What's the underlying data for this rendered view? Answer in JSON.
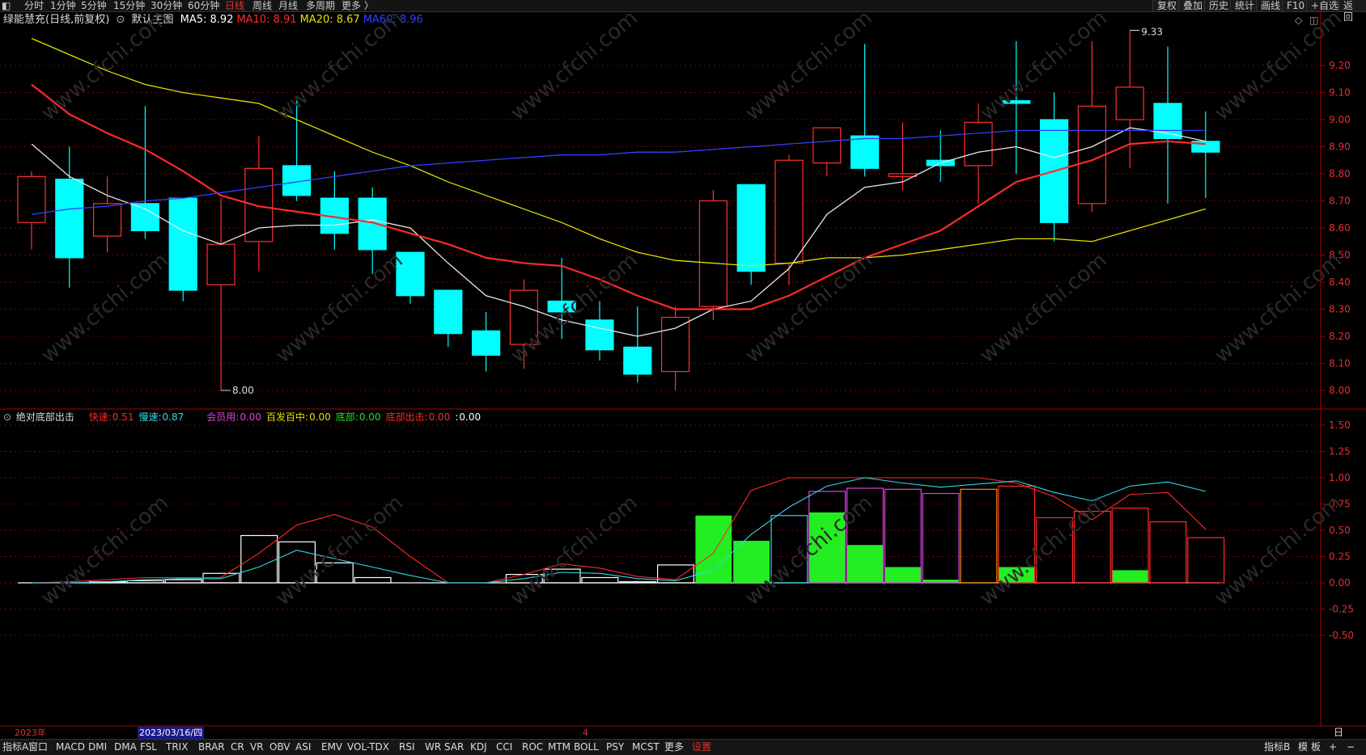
{
  "toolbar": {
    "left_tabs": [
      {
        "label": "分时",
        "x": 30
      },
      {
        "label": "1分钟",
        "x": 62
      },
      {
        "label": "5分钟",
        "x": 100
      },
      {
        "label": "15分钟",
        "x": 140
      },
      {
        "label": "30分钟",
        "x": 186
      },
      {
        "label": "60分钟",
        "x": 232
      },
      {
        "label": "日线",
        "x": 278,
        "active": true
      },
      {
        "label": "周线",
        "x": 312
      },
      {
        "label": "月线",
        "x": 344
      },
      {
        "label": "多周期",
        "x": 378
      },
      {
        "label": "更多 〉",
        "x": 422
      }
    ],
    "right_buttons": [
      "复权",
      "叠加",
      "历史",
      "统计",
      "画线",
      "F10",
      "+自选",
      "返回"
    ]
  },
  "header": {
    "stock_name": "绿能慧充(日线,前复权)",
    "main_chart": "默认主图",
    "ma": [
      {
        "label": "MA5: 8.92",
        "color": "#ffffff"
      },
      {
        "label": "MA10: 8.91",
        "color": "#ff2a2a"
      },
      {
        "label": "MA20: 8.67",
        "color": "#e0e000"
      },
      {
        "label": "MA60: 8.96",
        "color": "#3040ff"
      }
    ]
  },
  "indicator": {
    "name": "绝对底部出击",
    "values": [
      {
        "label": "快速:",
        "value": "0.51",
        "lcolor": "#ff2a2a",
        "vcolor": "#ff2a2a"
      },
      {
        "label": "慢速:",
        "value": "0.87",
        "lcolor": "#30d8e8",
        "vcolor": "#30d8e8"
      },
      {
        "label": "会员用:",
        "value": "0.00",
        "lcolor": "#e040e0",
        "vcolor": "#e040e0"
      },
      {
        "label": "百发百中:",
        "value": "0.00",
        "lcolor": "#e0e000",
        "vcolor": "#e0e000"
      },
      {
        "label": "底部:",
        "value": "0.00",
        "lcolor": "#22e022",
        "vcolor": "#22e022"
      },
      {
        "label": "底部出击:",
        "value": "0.00",
        "lcolor": "#ff2a2a",
        "vcolor": "#ff2a2a"
      },
      {
        "label": ":",
        "value": "0.00",
        "lcolor": "#ffffff",
        "vcolor": "#ffffff"
      }
    ]
  },
  "chart_data": [
    {
      "type": "candlestick",
      "title": "绿能慧充(日线,前复权)",
      "ylim": [
        7.97,
        9.33
      ],
      "yticks": [
        8.0,
        8.1,
        8.2,
        8.3,
        8.4,
        8.5,
        8.6,
        8.7,
        8.8,
        8.9,
        9.0,
        9.1,
        9.2
      ],
      "candles": [
        {
          "o": 8.62,
          "c": 8.79,
          "h": 8.81,
          "l": 8.52
        },
        {
          "o": 8.78,
          "c": 8.49,
          "h": 8.9,
          "l": 8.38
        },
        {
          "o": 8.57,
          "c": 8.69,
          "h": 8.79,
          "l": 8.51
        },
        {
          "o": 8.69,
          "c": 8.59,
          "h": 9.05,
          "l": 8.56
        },
        {
          "o": 8.71,
          "c": 8.37,
          "h": 8.71,
          "l": 8.33
        },
        {
          "o": 8.39,
          "c": 8.54,
          "h": 8.71,
          "l": 8.0
        },
        {
          "o": 8.55,
          "c": 8.82,
          "h": 8.94,
          "l": 8.44
        },
        {
          "o": 8.83,
          "c": 8.72,
          "h": 9.07,
          "l": 8.7
        },
        {
          "o": 8.71,
          "c": 8.58,
          "h": 8.81,
          "l": 8.52
        },
        {
          "o": 8.71,
          "c": 8.52,
          "h": 8.75,
          "l": 8.43
        },
        {
          "o": 8.51,
          "c": 8.35,
          "h": 8.51,
          "l": 8.32
        },
        {
          "o": 8.37,
          "c": 8.21,
          "h": 8.37,
          "l": 8.16
        },
        {
          "o": 8.22,
          "c": 8.13,
          "h": 8.29,
          "l": 8.07
        },
        {
          "o": 8.17,
          "c": 8.37,
          "h": 8.41,
          "l": 8.08
        },
        {
          "o": 8.33,
          "c": 8.29,
          "h": 8.49,
          "l": 8.19
        },
        {
          "o": 8.26,
          "c": 8.15,
          "h": 8.33,
          "l": 8.11
        },
        {
          "o": 8.16,
          "c": 8.06,
          "h": 8.31,
          "l": 8.03
        },
        {
          "o": 8.07,
          "c": 8.27,
          "h": 8.31,
          "l": 8.0
        },
        {
          "o": 8.31,
          "c": 8.7,
          "h": 8.74,
          "l": 8.26
        },
        {
          "o": 8.76,
          "c": 8.44,
          "h": 8.76,
          "l": 8.39
        },
        {
          "o": 8.47,
          "c": 8.85,
          "h": 8.87,
          "l": 8.39
        },
        {
          "o": 8.84,
          "c": 8.97,
          "h": 8.97,
          "l": 8.79
        },
        {
          "o": 8.94,
          "c": 8.82,
          "h": 9.28,
          "l": 8.79
        },
        {
          "o": 8.79,
          "c": 8.8,
          "h": 8.99,
          "l": 8.74
        },
        {
          "o": 8.85,
          "c": 8.83,
          "h": 8.96,
          "l": 8.77
        },
        {
          "o": 8.83,
          "c": 8.99,
          "h": 9.06,
          "l": 8.69
        },
        {
          "o": 9.07,
          "c": 9.06,
          "h": 9.29,
          "l": 8.8
        },
        {
          "o": 9.0,
          "c": 8.62,
          "h": 9.1,
          "l": 8.55
        },
        {
          "o": 8.69,
          "c": 9.05,
          "h": 9.29,
          "l": 8.66
        },
        {
          "o": 9.0,
          "c": 9.12,
          "h": 9.33,
          "l": 8.82
        },
        {
          "o": 9.06,
          "c": 8.93,
          "h": 9.27,
          "l": 8.69
        },
        {
          "o": 8.92,
          "c": 8.88,
          "h": 9.03,
          "l": 8.71
        }
      ],
      "series": [
        {
          "name": "MA5",
          "color": "#e8e8e8",
          "values": [
            8.91,
            8.79,
            8.72,
            8.67,
            8.59,
            8.54,
            8.6,
            8.61,
            8.61,
            8.63,
            8.6,
            8.47,
            8.35,
            8.31,
            8.26,
            8.23,
            8.2,
            8.23,
            8.3,
            8.33,
            8.45,
            8.65,
            8.75,
            8.77,
            8.84,
            8.88,
            8.9,
            8.86,
            8.9,
            8.97,
            8.95,
            8.92
          ]
        },
        {
          "name": "MA10",
          "color": "#ff2a2a",
          "values": [
            9.13,
            9.02,
            8.95,
            8.89,
            8.81,
            8.72,
            8.68,
            8.66,
            8.64,
            8.62,
            8.58,
            8.54,
            8.49,
            8.47,
            8.46,
            8.41,
            8.35,
            8.3,
            8.3,
            8.3,
            8.35,
            8.42,
            8.49,
            8.54,
            8.59,
            8.68,
            8.77,
            8.81,
            8.85,
            8.91,
            8.92,
            8.91
          ]
        },
        {
          "name": "MA20",
          "color": "#e0e000",
          "values": [
            9.3,
            9.24,
            9.18,
            9.13,
            9.1,
            9.08,
            9.06,
            9.0,
            8.94,
            8.88,
            8.83,
            8.77,
            8.72,
            8.67,
            8.62,
            8.56,
            8.51,
            8.48,
            8.47,
            8.46,
            8.47,
            8.49,
            8.49,
            8.5,
            8.52,
            8.54,
            8.56,
            8.56,
            8.55,
            8.59,
            8.63,
            8.67
          ]
        },
        {
          "name": "MA60",
          "color": "#3040ff",
          "values": [
            8.65,
            8.67,
            8.68,
            8.7,
            8.71,
            8.73,
            8.75,
            8.77,
            8.79,
            8.81,
            8.83,
            8.84,
            8.85,
            8.86,
            8.87,
            8.87,
            8.88,
            8.88,
            8.89,
            8.9,
            8.91,
            8.92,
            8.93,
            8.93,
            8.94,
            8.95,
            8.96,
            8.96,
            8.96,
            8.96,
            8.96,
            8.96
          ]
        }
      ],
      "annotations": [
        {
          "label": "8.00",
          "at_candle": 5,
          "value": 8.0
        },
        {
          "label": "9.33",
          "at_candle": 29,
          "value": 9.33
        }
      ]
    },
    {
      "type": "bar",
      "title": "绝对底部出击",
      "ylim": [
        -0.7,
        1.6
      ],
      "yticks": [
        1.5,
        1.25,
        1.0,
        0.75,
        0.5,
        0.25,
        0.0,
        -0.25,
        -0.5
      ],
      "bars": [
        {
          "v": 0.0,
          "g": 0,
          "c": "#ffffff"
        },
        {
          "v": 0.0,
          "g": 0,
          "c": "#ffffff"
        },
        {
          "v": 0.01,
          "g": 0,
          "c": "#ffffff"
        },
        {
          "v": 0.02,
          "g": 0,
          "c": "#ffffff"
        },
        {
          "v": 0.03,
          "g": 0,
          "c": "#ffffff"
        },
        {
          "v": 0.09,
          "g": 0,
          "c": "#ffffff"
        },
        {
          "v": 0.45,
          "g": 0,
          "c": "#ffffff"
        },
        {
          "v": 0.39,
          "g": 0,
          "c": "#ffffff"
        },
        {
          "v": 0.19,
          "g": 0,
          "c": "#ffffff"
        },
        {
          "v": 0.05,
          "g": 0,
          "c": "#ffffff"
        },
        {
          "v": 0.0,
          "g": 0,
          "c": "#ffffff"
        },
        {
          "v": 0.0,
          "g": 0,
          "c": "#ffffff"
        },
        {
          "v": 0.0,
          "g": 0,
          "c": "#ffffff"
        },
        {
          "v": 0.08,
          "g": 0,
          "c": "#ffffff"
        },
        {
          "v": 0.13,
          "g": 0,
          "c": "#ffffff"
        },
        {
          "v": 0.05,
          "g": 0,
          "c": "#ffffff"
        },
        {
          "v": 0.01,
          "g": 0,
          "c": "#ffffff"
        },
        {
          "v": 0.17,
          "g": 0,
          "c": "#ffffff"
        },
        {
          "v": 0.0,
          "g": 0.64,
          "c": "#22e022"
        },
        {
          "v": 0.0,
          "g": 0.4,
          "c": "#22e022"
        },
        {
          "v": 0.64,
          "g": 0,
          "c": "#30d8e8"
        },
        {
          "v": 0.87,
          "g": 0.67,
          "c": "#e040e0"
        },
        {
          "v": 0.9,
          "g": 0.36,
          "c": "#e040e0"
        },
        {
          "v": 0.89,
          "g": 0.15,
          "c": "#e040e0"
        },
        {
          "v": 0.85,
          "g": 0.03,
          "c": "#e040e0"
        },
        {
          "v": 0.89,
          "g": 0,
          "c": "#ff8c00"
        },
        {
          "v": 0.92,
          "g": 0.15,
          "c": "#ff2a2a"
        },
        {
          "v": 0.62,
          "g": 0,
          "c": "#ff2a2a"
        },
        {
          "v": 0.68,
          "g": 0,
          "c": "#ff2a2a"
        },
        {
          "v": 0.71,
          "g": 0.12,
          "c": "#ff2a2a"
        },
        {
          "v": 0.58,
          "g": 0,
          "c": "#ff2a2a"
        },
        {
          "v": 0.43,
          "g": 0,
          "c": "#ff2a2a"
        }
      ],
      "series": [
        {
          "name": "快速",
          "color": "#ff2a2a",
          "values": [
            0.0,
            0.01,
            0.03,
            0.05,
            0.05,
            0.05,
            0.28,
            0.55,
            0.65,
            0.53,
            0.25,
            0.0,
            0.0,
            0.08,
            0.18,
            0.14,
            0.06,
            0.03,
            0.28,
            0.88,
            1.0,
            1.0,
            1.0,
            1.0,
            1.0,
            1.0,
            0.95,
            0.82,
            0.6,
            0.84,
            0.86,
            0.51
          ]
        },
        {
          "name": "慢速",
          "color": "#30d8e8",
          "values": [
            0.0,
            0.0,
            0.01,
            0.03,
            0.04,
            0.04,
            0.15,
            0.31,
            0.23,
            0.15,
            0.07,
            0.0,
            0.0,
            0.04,
            0.1,
            0.09,
            0.04,
            0.02,
            0.12,
            0.46,
            0.72,
            0.92,
            1.0,
            0.95,
            0.91,
            0.94,
            0.97,
            0.86,
            0.78,
            0.92,
            0.96,
            0.87
          ]
        }
      ]
    }
  ],
  "datebar": {
    "year": "2023年",
    "cursor_date": "2023/03/16/四",
    "month_mark": "4",
    "period": "日线"
  },
  "bottombar": {
    "tabs": [
      "指标A",
      "窗口",
      "MACD",
      "DMI",
      "DMA",
      "FSL",
      "TRIX",
      "BRAR",
      "CR",
      "VR",
      "OBV",
      "ASI",
      "EMV",
      "VOL-TDX",
      "RSI",
      "WR",
      "SAR",
      "KDJ",
      "CCI",
      "ROC",
      "MTM",
      "BOLL",
      "PSY",
      "MCST",
      "更多",
      "设置"
    ],
    "right": [
      "指标B",
      "模",
      "板",
      "+",
      "−"
    ]
  },
  "colors": {
    "up": "#ff3030",
    "down": "#00ffff",
    "grid": "#7a0000",
    "axis": "#b00000",
    "text": "#dddddd"
  }
}
